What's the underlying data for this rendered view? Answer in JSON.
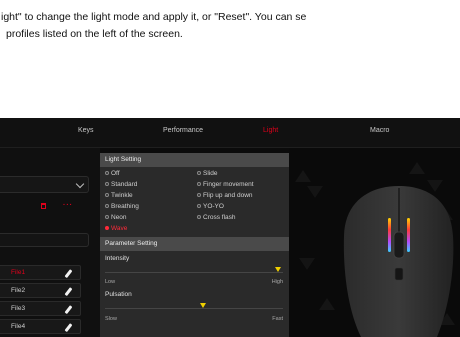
{
  "instructions": {
    "line1": "ight\" to change the light mode and apply it, or \"Reset\". You can se",
    "line2": "profiles listed on the left of the screen."
  },
  "tabs": [
    {
      "label": "Keys",
      "active": false
    },
    {
      "label": "Performance",
      "active": false
    },
    {
      "label": "Light",
      "active": true
    },
    {
      "label": "Macro",
      "active": false
    }
  ],
  "profiles": [
    "File1",
    "File2",
    "File3",
    "File4"
  ],
  "active_profile": "File1",
  "light_setting": {
    "header": "Light Setting",
    "modes_left": [
      "Off",
      "Standard",
      "Twinkle",
      "Breathing",
      "Neon",
      "Wave"
    ],
    "modes_right": [
      "Slide",
      "Finger movement",
      "Flip up and down",
      "YO-YO",
      "Cross flash"
    ],
    "selected": "Wave"
  },
  "parameter_setting": {
    "header": "Parameter Setting",
    "intensity": {
      "label": "Intensity",
      "min_label": "Low",
      "max_label": "High",
      "level": 0.97
    },
    "pulsation": {
      "label": "Pulsation",
      "min_label": "Slow",
      "max_label": "Fast",
      "level": 0.55
    }
  },
  "colors": {
    "accent": "#e0001b",
    "slider": "#f0d000",
    "panel_header": "#4a4a4a"
  },
  "icons": [
    "chevron-down-icon",
    "trash-icon",
    "more-icon",
    "pencil-icon"
  ]
}
